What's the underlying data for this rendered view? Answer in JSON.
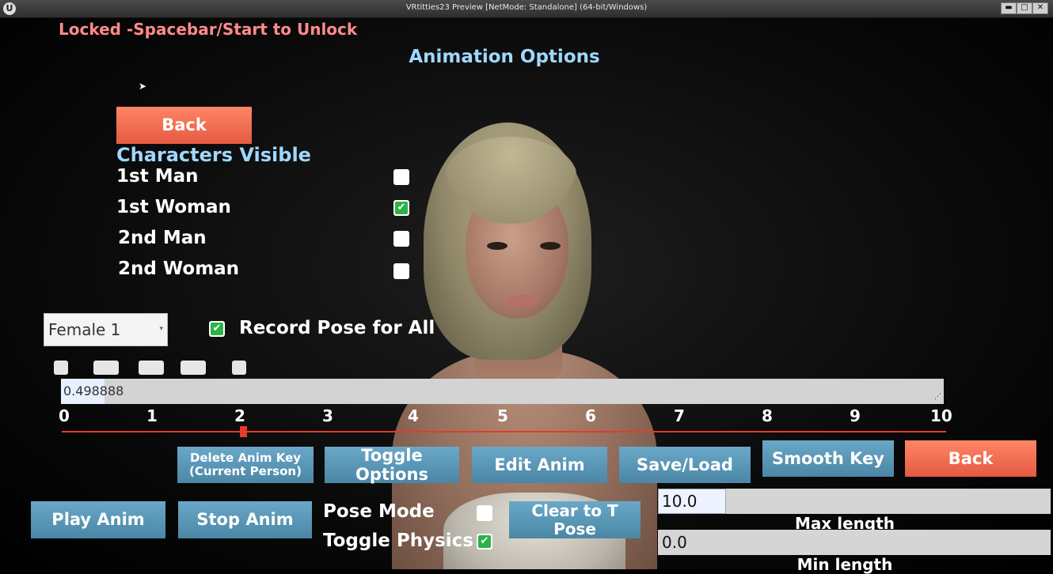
{
  "window": {
    "title": "VRtitties23 Preview [NetMode: Standalone]  (64-bit/Windows)",
    "minimize": "▬",
    "maximize": "□",
    "close": "✕"
  },
  "header": {
    "lock_status": "Locked -Spacebar/Start to Unlock",
    "title": "Animation Options"
  },
  "left_panel": {
    "back_label": "Back",
    "section_title": "Characters Visible",
    "characters": [
      {
        "label": "1st Man",
        "checked": false
      },
      {
        "label": "1st Woman",
        "checked": true
      },
      {
        "label": "2nd Man",
        "checked": false
      },
      {
        "label": "2nd Woman",
        "checked": false
      }
    ]
  },
  "person_select": {
    "value": "Female 1"
  },
  "record_pose": {
    "label": "Record Pose for All",
    "checked": true
  },
  "timeline": {
    "value": "0.498888",
    "ticks": [
      "0",
      "1",
      "2",
      "3",
      "4",
      "5",
      "6",
      "7",
      "8",
      "9",
      "10"
    ],
    "scrub_value": 2.05
  },
  "toolbar": {
    "delete_key_line1": "Delete Anim Key",
    "delete_key_line2": "(Current Person)",
    "toggle_options": "Toggle Options",
    "edit_anim": "Edit Anim",
    "save_load": "Save/Load",
    "smooth_key": "Smooth Key",
    "back": "Back",
    "play_anim": "Play Anim",
    "stop_anim": "Stop Anim",
    "clear_pose": "Clear to T Pose"
  },
  "modes": {
    "pose_mode_label": "Pose Mode",
    "pose_mode_checked": false,
    "toggle_physics_label": "Toggle Physics",
    "toggle_physics_checked": true
  },
  "length_fields": {
    "max_value": "10.0",
    "max_label": "Max length",
    "min_value": "0.0",
    "min_label": "Min length"
  },
  "colors": {
    "accent_red": "#e45a40",
    "accent_blue": "#4b86a6",
    "title_blue": "#9fd8ff",
    "lock_red": "#ff8a8a",
    "check_green": "#2bb34a"
  }
}
